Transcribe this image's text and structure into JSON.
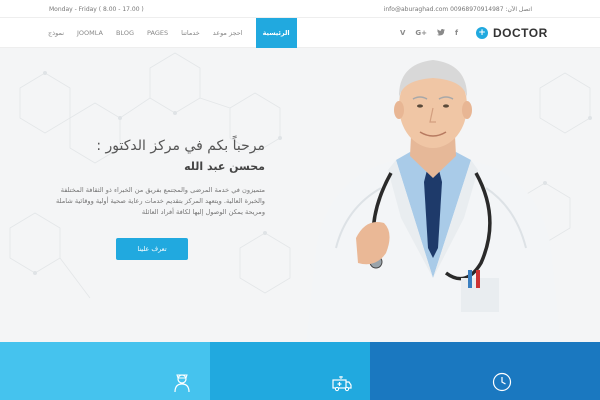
{
  "topbar": {
    "hours": "Monday - Friday ( 8.00 - 17.00 )",
    "contact": "info@aburaghad.com 00968970914987 :اتصل الآن"
  },
  "nav": {
    "logo_text": "DOCTOR",
    "items": [
      {
        "label": "نموذج"
      },
      {
        "label": "JOOMLA"
      },
      {
        "label": "BLOG"
      },
      {
        "label": "PAGES"
      },
      {
        "label": "خدماتنا"
      },
      {
        "label": "احجز موعد"
      },
      {
        "label": "الرئيسية",
        "active": true
      }
    ],
    "social_icons": [
      "vine-icon",
      "google-plus-icon",
      "twitter-icon",
      "facebook-icon"
    ]
  },
  "hero": {
    "title": "مرحباً بكم في مركز الدكتور :",
    "name": "محسن عبد الله",
    "description": "متميزون في خدمة المرضى والمجتمع بفريق من الخبراء ذو الثقافة المختلفة والخبرة العالية. ويتعهد المركز بتقديم خدمات رعاية صحية أولية ووقائية شاملة ومريحة يمكن الوصول إليها لكافة أفراد العائلة",
    "button_label": "تعرف علينا"
  },
  "panels": [
    {
      "icon": "nurse-icon",
      "color": "#45c3ee"
    },
    {
      "icon": "ambulance-icon",
      "color": "#21a9df"
    },
    {
      "icon": "clock-icon",
      "color": "#1a78c0"
    }
  ]
}
